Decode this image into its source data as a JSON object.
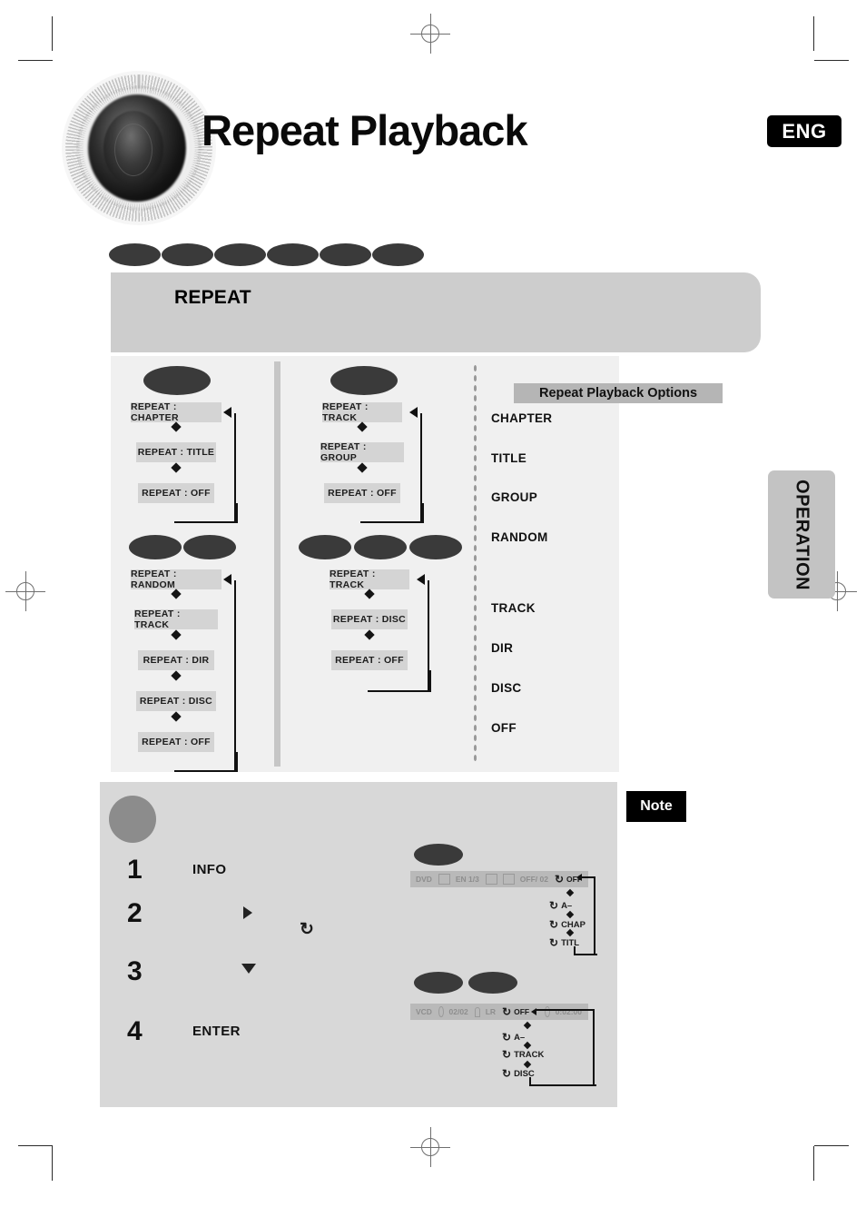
{
  "page": {
    "title": "Repeat Playback",
    "language_badge": "ENG",
    "side_tab": "OPERATION",
    "note_badge": "Note"
  },
  "section": {
    "band_label": "REPEAT"
  },
  "flow": {
    "columns": [
      {
        "id": "dvd-chapter",
        "disc_icons": [
          "disc-icon",
          "disc-icon"
        ],
        "disc_icon_count": 1,
        "steps": [
          "REPEAT : CHAPTER",
          "REPEAT : TITLE",
          "REPEAT : OFF"
        ]
      },
      {
        "id": "dvd-audio-track",
        "disc_icon_count": 1,
        "steps": [
          "REPEAT : TRACK",
          "REPEAT : GROUP",
          "REPEAT : OFF"
        ]
      },
      {
        "id": "mp3-random",
        "disc_icon_count": 2,
        "steps": [
          "REPEAT : RANDOM",
          "REPEAT : TRACK",
          "REPEAT : DIR",
          "REPEAT : DISC",
          "REPEAT : OFF"
        ]
      },
      {
        "id": "cd-vcd-track",
        "disc_icon_count": 3,
        "steps": [
          "REPEAT : TRACK",
          "REPEAT : DISC",
          "REPEAT : OFF"
        ]
      }
    ]
  },
  "options": {
    "title": "Repeat Playback Options",
    "items": [
      "CHAPTER",
      "TITLE",
      "GROUP",
      "RANDOM",
      "TRACK",
      "DIR",
      "DISC",
      "OFF"
    ]
  },
  "note": {
    "steps": [
      {
        "number": "1",
        "label": "INFO"
      },
      {
        "number": "2",
        "label": "",
        "arrow": "right-arrow-icon",
        "repeat_icon": "repeat-icon"
      },
      {
        "number": "3",
        "label": "",
        "arrow": "down-arrow-icon"
      },
      {
        "number": "4",
        "label": "ENTER"
      }
    ]
  },
  "osd": {
    "dvd": {
      "disc_icon_count": 1,
      "bar": {
        "disc_type": "DVD",
        "video_icon": "video-icon",
        "audio": "EN 1/3",
        "audio_format_icon": "digital-icon",
        "subtitle_icon": "subtitle-icon",
        "subtitle": "OFF/ 02",
        "repeat_icon": "repeat-icon",
        "repeat_value": "OFF"
      },
      "cycle": [
        "OFF",
        "A–",
        "CHAP",
        "TITL"
      ]
    },
    "vcd": {
      "disc_icon_count": 2,
      "bar": {
        "disc_type": "VCD",
        "track_icon": "track-icon",
        "track": "02/02",
        "audio_icon": "headphone-icon",
        "audio": "LR",
        "repeat_icon": "repeat-icon",
        "repeat_value": "OFF",
        "time_icon": "clock-icon",
        "time": "0:02:00"
      },
      "cycle": [
        "OFF",
        "A–",
        "TRACK",
        "DISC"
      ]
    }
  },
  "colors": {
    "band": "#cdcdcd",
    "panel": "#f0f0f0",
    "box": "#d4d4d4",
    "disc": "#3a3a3a",
    "note_panel": "#d8d8d8",
    "accent_black": "#000000"
  }
}
